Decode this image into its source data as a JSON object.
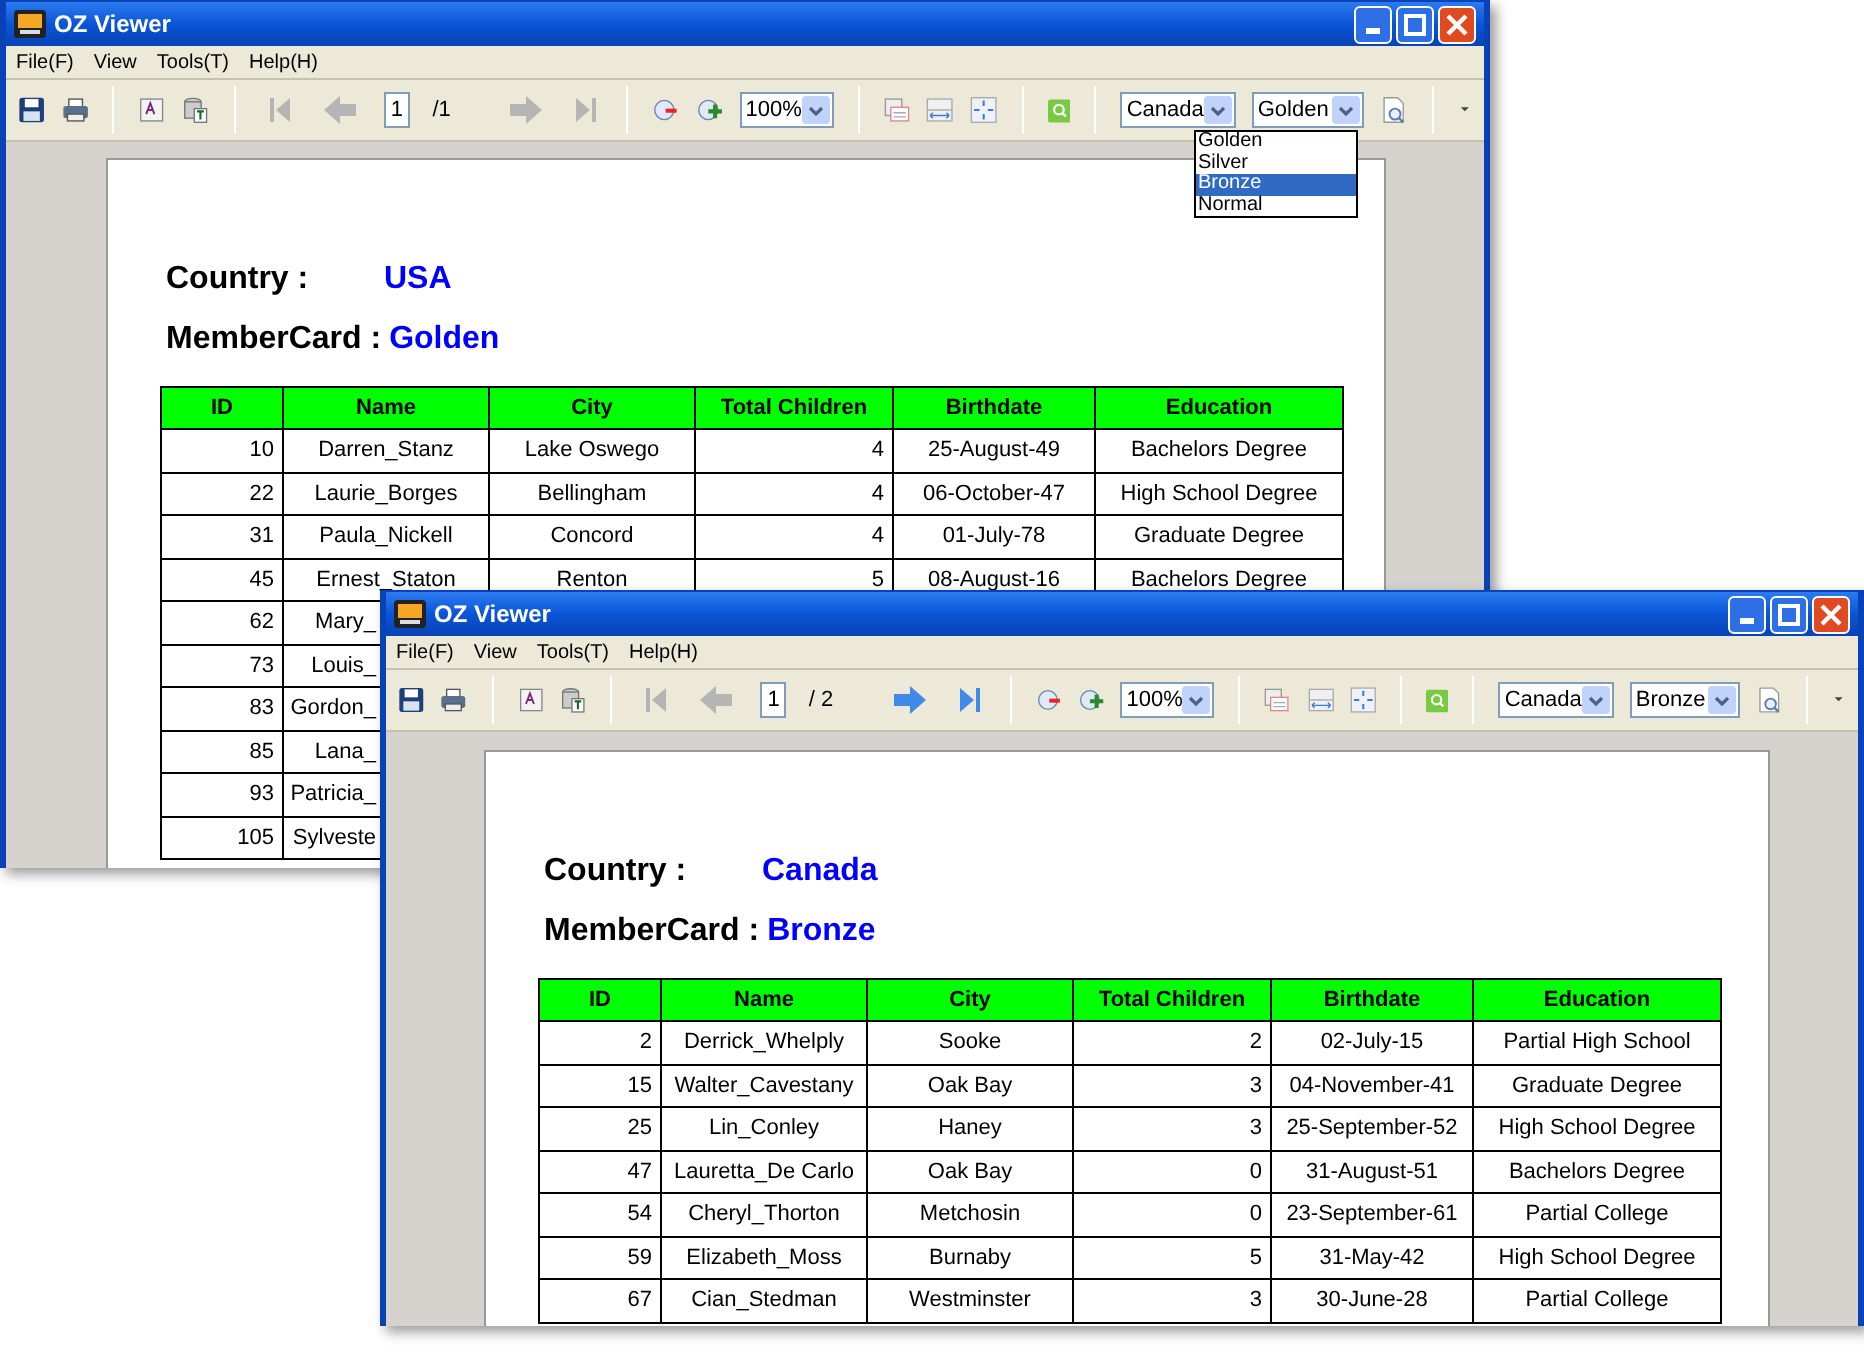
{
  "windows": [
    {
      "title": "OZ Viewer",
      "menu": [
        "File(F)",
        "View",
        "Tools(T)",
        "Help(H)"
      ],
      "toolbar": {
        "page": "1",
        "page_total": "/1",
        "back_enabled": false,
        "forward_enabled": false,
        "zoom": "100%",
        "country": "Canada",
        "membercard": "Golden"
      },
      "dropdown": {
        "options": [
          {
            "label": "Golden",
            "selected": false
          },
          {
            "label": "Silver",
            "selected": false
          },
          {
            "label": "Bronze",
            "selected": true
          },
          {
            "label": "Normal",
            "selected": false
          }
        ]
      },
      "report": {
        "country_label": "Country :",
        "country": "USA",
        "card_label": "MemberCard :",
        "card": "Golden",
        "columns": [
          "ID",
          "Name",
          "City",
          "Total Children",
          "Birthdate",
          "Education"
        ],
        "rows": [
          [
            "10",
            "Darren_Stanz",
            "Lake Oswego",
            "4",
            "25-August-49",
            "Bachelors Degree"
          ],
          [
            "22",
            "Laurie_Borges",
            "Bellingham",
            "4",
            "06-October-47",
            "High School Degree"
          ],
          [
            "31",
            "Paula_Nickell",
            "Concord",
            "4",
            "01-July-78",
            "Graduate Degree"
          ],
          [
            "45",
            "Ernest_Staton",
            "Renton",
            "5",
            "08-August-16",
            "Bachelors Degree"
          ],
          [
            "62",
            "Mary_"
          ],
          [
            "73",
            "Louis_"
          ],
          [
            "83",
            "Gordon_"
          ],
          [
            "85",
            "Lana_"
          ],
          [
            "93",
            "Patricia_"
          ],
          [
            "105",
            "Sylveste"
          ]
        ]
      }
    },
    {
      "title": "OZ Viewer",
      "menu": [
        "File(F)",
        "View",
        "Tools(T)",
        "Help(H)"
      ],
      "toolbar": {
        "page": "1",
        "page_total": "/ 2",
        "back_enabled": false,
        "forward_enabled": true,
        "zoom": "100%",
        "country": "Canada",
        "membercard": "Bronze"
      },
      "report": {
        "country_label": "Country :",
        "country": "Canada",
        "card_label": "MemberCard :",
        "card": "Bronze",
        "columns": [
          "ID",
          "Name",
          "City",
          "Total Children",
          "Birthdate",
          "Education"
        ],
        "rows": [
          [
            "2",
            "Derrick_Whelply",
            "Sooke",
            "2",
            "02-July-15",
            "Partial High School"
          ],
          [
            "15",
            "Walter_Cavestany",
            "Oak Bay",
            "3",
            "04-November-41",
            "Graduate Degree"
          ],
          [
            "25",
            "Lin_Conley",
            "Haney",
            "3",
            "25-September-52",
            "High School Degree"
          ],
          [
            "47",
            "Lauretta_De Carlo",
            "Oak Bay",
            "0",
            "31-August-51",
            "Bachelors Degree"
          ],
          [
            "54",
            "Cheryl_Thorton",
            "Metchosin",
            "0",
            "23-September-61",
            "Partial College"
          ],
          [
            "59",
            "Elizabeth_Moss",
            "Burnaby",
            "5",
            "31-May-42",
            "High School Degree"
          ],
          [
            "67",
            "Cian_Stedman",
            "Westminster",
            "3",
            "30-June-28",
            "Partial College"
          ]
        ]
      }
    }
  ]
}
